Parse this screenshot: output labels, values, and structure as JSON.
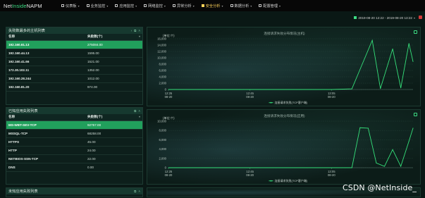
{
  "brand": {
    "name_a": "Net",
    "name_b": "Inside",
    "name_c": " NAPM"
  },
  "nav": [
    {
      "label": "仪表板",
      "active": false
    },
    {
      "label": "业务监控",
      "active": false
    },
    {
      "label": "应用监控",
      "active": false
    },
    {
      "label": "网络监控",
      "active": false
    },
    {
      "label": "异常分析",
      "active": false
    },
    {
      "label": "安全分析",
      "active": true
    },
    {
      "label": "数据分析",
      "active": false
    },
    {
      "label": "配置管理",
      "active": false
    }
  ],
  "date_range": "2019-08-20 12:22 - 2019-08-20 13:22",
  "hosts_panel": {
    "title": "失败数最多的主机列表",
    "col_name": "名称",
    "col_value": "失败数(个)",
    "rows": [
      {
        "name": "192.160.61.13",
        "value": "275084.00"
      },
      {
        "name": "192.160.44.13",
        "value": "1595.00"
      },
      {
        "name": "192.160.41.66",
        "value": "1521.00"
      },
      {
        "name": "172.30.102.11",
        "value": "1352.00"
      },
      {
        "name": "192.160.28.244",
        "value": "1012.00"
      },
      {
        "name": "192.160.81.20",
        "value": "974.00"
      }
    ]
  },
  "apps_panel": {
    "title": "已知应用失败列表",
    "col_name": "名称",
    "col_value": "失败数(个)",
    "rows": [
      {
        "name": "MS-WBT-SEV-TCP",
        "value": "92757.00"
      },
      {
        "name": "MSSQL-TCP",
        "value": "68258.00"
      },
      {
        "name": "HTTPS",
        "value": "45.00"
      },
      {
        "name": "HTTP",
        "value": "24.00"
      },
      {
        "name": "NETBIOS-SSN-TCP",
        "value": "22.00"
      },
      {
        "name": "DNS",
        "value": "0.00"
      }
    ]
  },
  "unknown_panel": {
    "title": "未知应用失败列表"
  },
  "watermark": "CSDN @NetInside_",
  "colors": {
    "accent": "#3ddc84",
    "line": "#35e07a",
    "selected_row": "#21a05c",
    "active_nav": "#ffd35a"
  },
  "chart_data": [
    {
      "type": "line",
      "title": "连接请求失败分布情况(主机)",
      "ylabel": "(单位:个)",
      "ylim": [
        0,
        16000
      ],
      "yticks": [
        "16,000",
        "14,000",
        "12,000",
        "10,000",
        "8,000",
        "6,000",
        "4,000",
        "2,000",
        "0"
      ],
      "xticks": [
        {
          "time": "12:25",
          "date": "08-20"
        },
        {
          "time": "12:45",
          "date": "08-20"
        },
        {
          "time": "13:05",
          "date": "08-20"
        }
      ],
      "series": [
        {
          "name": "连接请求失败(TCP客户端)",
          "x": [
            0,
            10,
            20,
            30,
            40,
            45,
            50,
            52,
            55,
            57,
            59,
            60
          ],
          "y": [
            0,
            0,
            0,
            0,
            0,
            200,
            15500,
            300,
            12800,
            500,
            14500,
            8800
          ]
        }
      ]
    },
    {
      "type": "line",
      "title": "连接请求失败分布情况(应用)",
      "ylabel": "(单位:个)",
      "ylim": [
        0,
        10000
      ],
      "yticks": [
        "10,000",
        "8,000",
        "6,000",
        "4,000",
        "2,000",
        "0"
      ],
      "xticks": [
        {
          "time": "12:25",
          "date": "08-20"
        },
        {
          "time": "12:45",
          "date": "08-20"
        },
        {
          "time": "13:05",
          "date": "08-20"
        }
      ],
      "series": [
        {
          "name": "连接请求失败(TCP客户端)",
          "x": [
            0,
            10,
            20,
            30,
            40,
            45,
            47,
            49,
            51,
            53,
            55,
            57,
            59,
            60
          ],
          "y": [
            0,
            0,
            0,
            0,
            0,
            0,
            8600,
            8500,
            1000,
            300,
            3900,
            300,
            5700,
            8500
          ]
        }
      ]
    }
  ]
}
